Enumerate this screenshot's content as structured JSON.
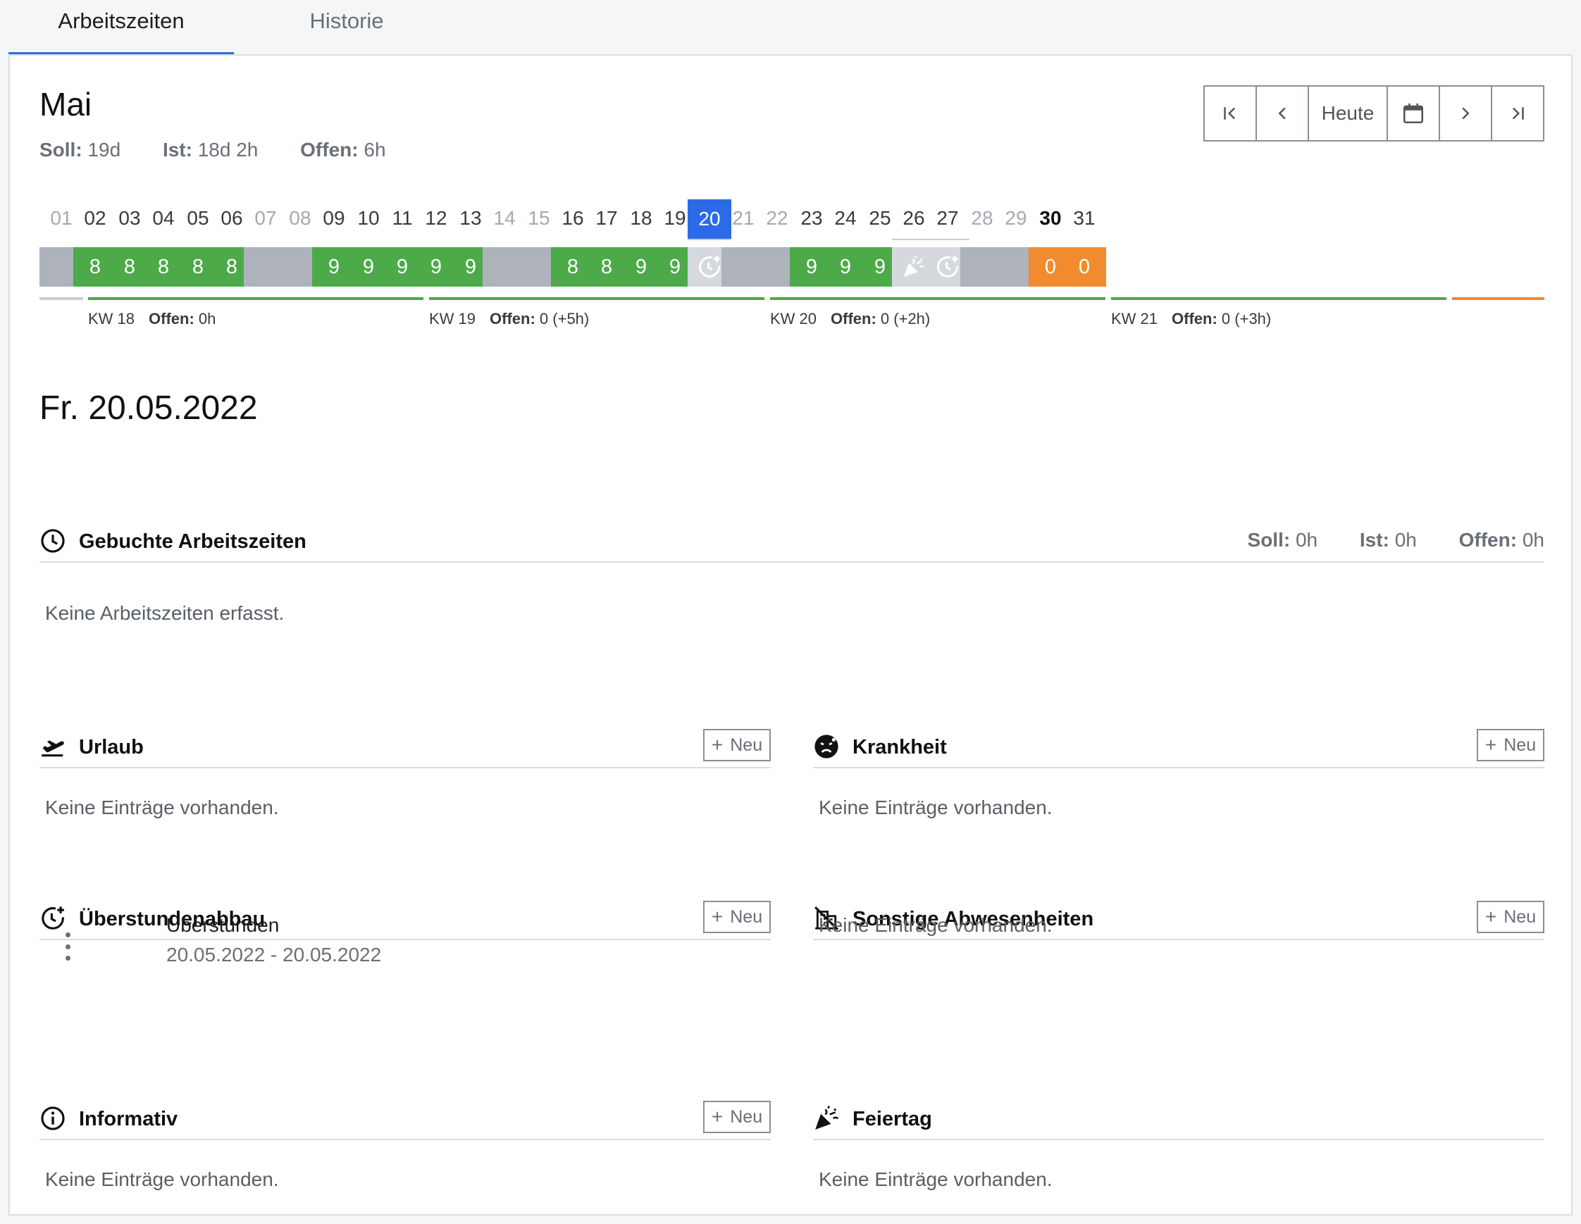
{
  "tabs": [
    {
      "label": "Arbeitszeiten",
      "active": true
    },
    {
      "label": "Historie",
      "active": false
    }
  ],
  "month": {
    "title": "Mai",
    "soll_label": "Soll:",
    "soll_value": "19d",
    "ist_label": "Ist:",
    "ist_value": "18d 2h",
    "offen_label": "Offen:",
    "offen_value": "6h"
  },
  "nav": {
    "first_icon": "first-page-icon",
    "prev_icon": "chevron-left-icon",
    "today_label": "Heute",
    "calendar_icon": "calendar-icon",
    "next_icon": "chevron-right-icon",
    "last_icon": "last-page-icon"
  },
  "calendar": {
    "days": [
      {
        "day": "01",
        "style": "weekend",
        "cell": "gray",
        "value": ""
      },
      {
        "day": "02",
        "style": "normal",
        "cell": "green",
        "value": "8"
      },
      {
        "day": "03",
        "style": "normal",
        "cell": "green",
        "value": "8"
      },
      {
        "day": "04",
        "style": "normal",
        "cell": "green",
        "value": "8"
      },
      {
        "day": "05",
        "style": "normal",
        "cell": "green",
        "value": "8"
      },
      {
        "day": "06",
        "style": "normal",
        "cell": "green",
        "value": "8"
      },
      {
        "day": "07",
        "style": "weekend",
        "cell": "gray",
        "value": ""
      },
      {
        "day": "08",
        "style": "weekend",
        "cell": "gray",
        "value": ""
      },
      {
        "day": "09",
        "style": "normal",
        "cell": "green",
        "value": "9"
      },
      {
        "day": "10",
        "style": "normal",
        "cell": "green",
        "value": "9"
      },
      {
        "day": "11",
        "style": "normal",
        "cell": "green",
        "value": "9"
      },
      {
        "day": "12",
        "style": "normal",
        "cell": "green",
        "value": "9"
      },
      {
        "day": "13",
        "style": "normal",
        "cell": "green",
        "value": "9"
      },
      {
        "day": "14",
        "style": "weekend",
        "cell": "gray",
        "value": ""
      },
      {
        "day": "15",
        "style": "weekend",
        "cell": "gray",
        "value": ""
      },
      {
        "day": "16",
        "style": "normal",
        "cell": "green",
        "value": "8"
      },
      {
        "day": "17",
        "style": "normal",
        "cell": "green",
        "value": "8"
      },
      {
        "day": "18",
        "style": "normal",
        "cell": "green",
        "value": "9"
      },
      {
        "day": "19",
        "style": "normal",
        "cell": "green",
        "value": "9"
      },
      {
        "day": "20",
        "style": "today",
        "cell": "light",
        "value": "",
        "icon": "overtime-clock-icon"
      },
      {
        "day": "21",
        "style": "weekend",
        "cell": "gray",
        "value": ""
      },
      {
        "day": "22",
        "style": "weekend",
        "cell": "gray",
        "value": ""
      },
      {
        "day": "23",
        "style": "normal",
        "cell": "green",
        "value": "9"
      },
      {
        "day": "24",
        "style": "normal",
        "cell": "green",
        "value": "9"
      },
      {
        "day": "25",
        "style": "normal",
        "cell": "green",
        "value": "9"
      },
      {
        "day": "26",
        "style": "normal",
        "cell": "light",
        "value": "",
        "icon": "party-popper-icon"
      },
      {
        "day": "27",
        "style": "normal",
        "cell": "light",
        "value": "",
        "icon": "overtime-clock-icon"
      },
      {
        "day": "28",
        "style": "weekend",
        "cell": "gray",
        "value": ""
      },
      {
        "day": "29",
        "style": "weekend",
        "cell": "gray",
        "value": ""
      },
      {
        "day": "30",
        "style": "bold",
        "cell": "orange",
        "value": "0"
      },
      {
        "day": "31",
        "style": "normal",
        "cell": "orange",
        "value": "0"
      }
    ],
    "weeks": [
      {
        "label": "KW 18",
        "offen_label": "Offen:",
        "offen_value": "0h"
      },
      {
        "label": "KW 19",
        "offen_label": "Offen:",
        "offen_value": "0 (+5h)"
      },
      {
        "label": "KW 20",
        "offen_label": "Offen:",
        "offen_value": "0 (+2h)"
      },
      {
        "label": "KW 21",
        "offen_label": "Offen:",
        "offen_value": "0 (+3h)"
      }
    ],
    "colors": {
      "green": "#4caa49",
      "gray": "#aeb3bb",
      "light": "#d5d9de",
      "orange": "#f28b2e",
      "today": "#2b6be8"
    }
  },
  "day": {
    "title": "Fr. 20.05.2022",
    "booked": {
      "title": "Gebuchte Arbeitszeiten",
      "icon": "clock-icon",
      "soll_label": "Soll:",
      "soll_value": "0h",
      "ist_label": "Ist:",
      "ist_value": "0h",
      "offen_label": "Offen:",
      "offen_value": "0h",
      "empty": "Keine Arbeitszeiten erfasst."
    },
    "sections": {
      "urlaub": {
        "title": "Urlaub",
        "icon": "airplane-takeoff-icon",
        "new_label": "Neu",
        "empty": "Keine Einträge vorhanden."
      },
      "krankheit": {
        "title": "Krankheit",
        "icon": "sick-face-icon",
        "new_label": "Neu",
        "empty": "Keine Einträge vorhanden."
      },
      "ueberstunden": {
        "title": "Überstundenabbau",
        "icon": "overtime-clock-icon",
        "new_label": "Neu",
        "entries": [
          {
            "title": "Überstunden",
            "range": "20.05.2022 - 20.05.2022"
          }
        ]
      },
      "sonstige": {
        "title": "Sonstige Abwesenheiten",
        "icon": "office-off-icon",
        "new_label": "Neu",
        "empty": "Keine Einträge vorhanden."
      },
      "informativ": {
        "title": "Informativ",
        "icon": "info-icon",
        "new_label": "Neu",
        "empty": "Keine Einträge vorhanden."
      },
      "feiertag": {
        "title": "Feiertag",
        "icon": "party-popper-icon",
        "empty": "Keine Einträge vorhanden."
      }
    }
  }
}
